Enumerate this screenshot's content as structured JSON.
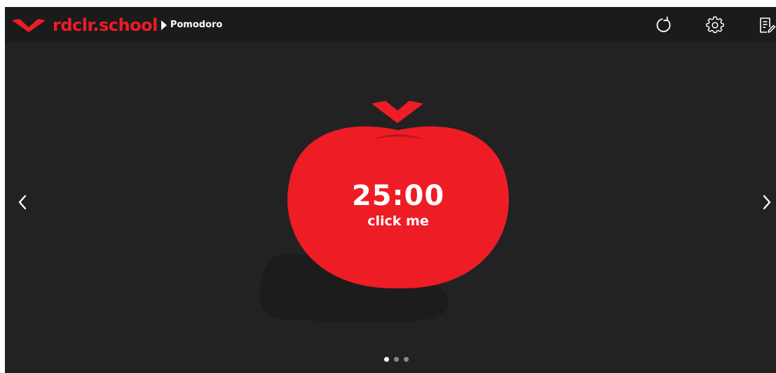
{
  "header": {
    "brand_name": "rdclr.school",
    "page_name": "Pomodoro",
    "logo_icon": "rdclr-logo-icon",
    "separator_icon": "caret-right-icon",
    "tools": [
      {
        "name": "reset",
        "icon": "reset-icon"
      },
      {
        "name": "settings",
        "icon": "gear-icon"
      },
      {
        "name": "notes",
        "icon": "notes-icon"
      }
    ]
  },
  "timer": {
    "time": "25:00",
    "hint": "click me"
  },
  "navigation": {
    "prev_icon": "chevron-left-icon",
    "next_icon": "chevron-right-icon"
  },
  "pager": {
    "count": 3,
    "active_index": 0
  },
  "colors": {
    "accent": "#ee1c25",
    "background": "#222222",
    "topbar": "#1b1b1b",
    "text": "#ffffff"
  }
}
